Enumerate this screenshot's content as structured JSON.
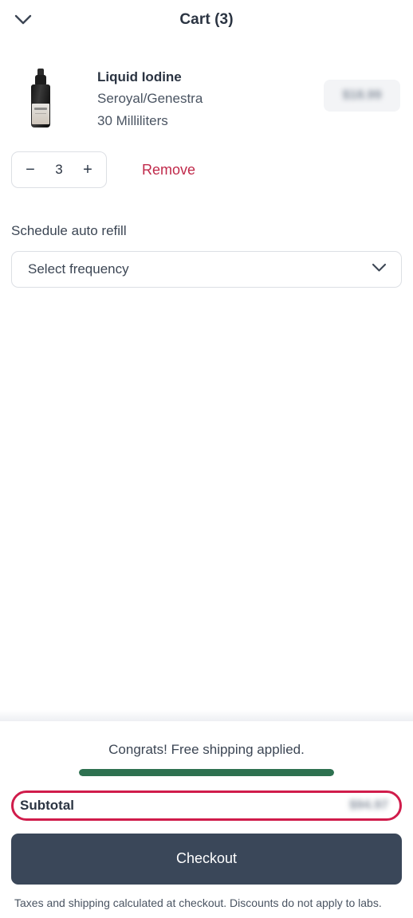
{
  "header": {
    "title": "Cart (3)",
    "collapse_icon": "chevron-down-icon"
  },
  "item": {
    "name": "Liquid Iodine",
    "brand": "Seroyal/Genestra",
    "size": "30 Milliliters",
    "price": "$18.99",
    "price_redacted": true,
    "thumbnail_icon": "dropper-bottle-image",
    "quantity": "3",
    "decrease_label": "−",
    "increase_label": "+",
    "remove_label": "Remove"
  },
  "auto_refill": {
    "label": "Schedule auto refill",
    "select_value": "Select frequency",
    "select_icon": "chevron-down-icon"
  },
  "footer": {
    "shipping_message": "Congrats! Free shipping applied.",
    "progress_percent": 100,
    "subtotal_label": "Subtotal",
    "subtotal_value": "$94.97",
    "subtotal_redacted": true,
    "checkout_label": "Checkout",
    "fine_print": "Taxes and shipping calculated at checkout. Discounts do not apply to labs."
  },
  "colors": {
    "accent_crimson": "#c0294a",
    "highlight_ring": "#d01c4b",
    "progress_green": "#2e7150",
    "checkout_navy": "#3a4759",
    "text_dark": "#2b3442",
    "text_muted": "#4a5462"
  }
}
